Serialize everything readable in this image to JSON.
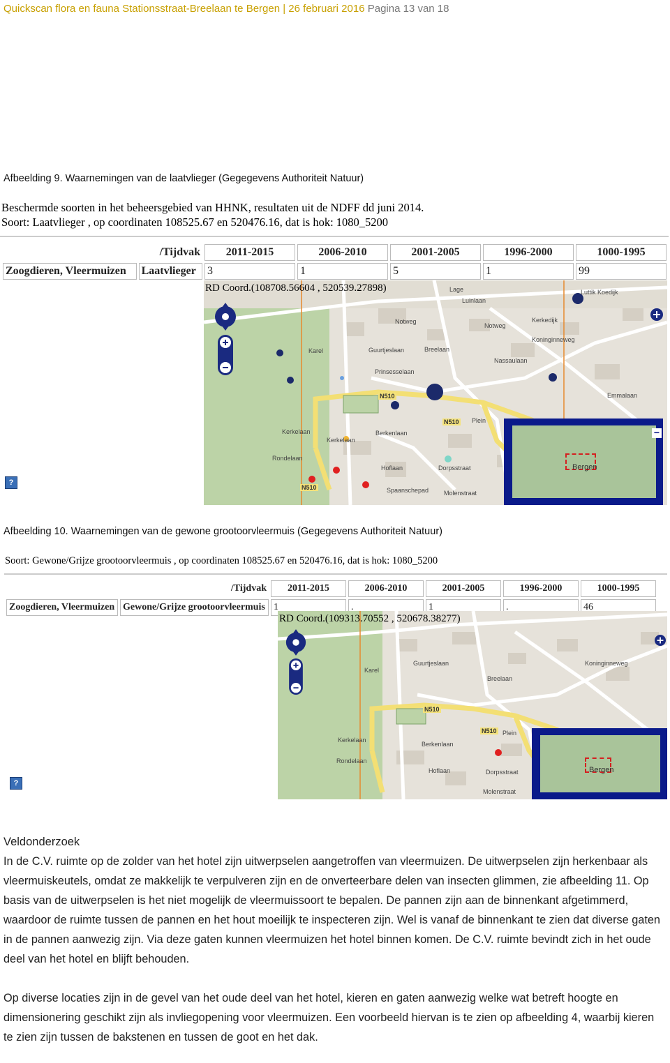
{
  "header": {
    "title": "Quickscan flora en fauna Stationsstraat-Breelaan te Bergen | 26 februari 2016",
    "page": "Pagina 13 van 18"
  },
  "figure9": {
    "caption": "Afbeelding 9. Waarnemingen van de laatvlieger (Gegegevens Authoriteit Natuur)",
    "line1": "Beschermde soorten in het beheersgebied van HHNK, resultaten uit de NDFF dd juni 2014.",
    "line2": "Soort: Laatvlieger , op coordinaten 108525.67 en 520476.16, dat is hok: 1080_5200",
    "table": {
      "headers": [
        "/Tijdvak",
        "2011-2015",
        "2006-2010",
        "2001-2005",
        "1996-2000",
        "1000-1995"
      ],
      "row": [
        "Zoogdieren, Vleermuizen",
        "Laatvlieger",
        "3",
        "1",
        "5",
        "1",
        "99"
      ]
    },
    "coord": "RD Coord.(108708.56604 , 520539.27898)",
    "map_labels": [
      "Luttik Koedijk",
      "Lage",
      "Luinlaan",
      "Notweg",
      "Notweg",
      "Kerkedijk",
      "Guurtjeslaan",
      "Prinsesselaan",
      "Breelaan",
      "Kerkelaan",
      "Kerkelaan",
      "Berkenlaan",
      "Hoflaan",
      "Dorpsstraat",
      "Molenstraat",
      "Spaanschepad",
      "Plein",
      "Emmalaan",
      "Koninginneweg",
      "Rondelaan",
      "Karel",
      "Nassaulaan"
    ],
    "road_labels": [
      "N510",
      "N510",
      "N510"
    ],
    "overview_label": "Bergen"
  },
  "figure10": {
    "caption": "Afbeelding 10. Waarnemingen van de gewone grootoorvleermuis (Gegegevens Authoriteit Natuur)",
    "line2": "Soort: Gewone/Grijze grootoorvleermuis , op coordinaten 108525.67 en 520476.16, dat is hok: 1080_5200",
    "table": {
      "headers": [
        "/Tijdvak",
        "2011-2015",
        "2006-2010",
        "2001-2005",
        "1996-2000",
        "1000-1995"
      ],
      "row": [
        "Zoogdieren, Vleermuizen",
        "Gewone/Grijze grootoorvleermuis",
        "1",
        ".",
        "1",
        ".",
        "46"
      ]
    },
    "coord": "RD Coord.(109313.70552 , 520678.38277)",
    "map_labels": [
      "Guurtjeslaan",
      "Breelaan",
      "Kerkelaan",
      "Berkenlaan",
      "Hoflaan",
      "Dorpsstraat",
      "Molenstraat",
      "Plein",
      "Koninginneweg",
      "Rondelaan",
      "Karel"
    ],
    "road_labels": [
      "N510",
      "N510"
    ],
    "overview_label": "Bergen"
  },
  "section": {
    "title": "Veldonderzoek",
    "paragraph1": "In de C.V. ruimte op de zolder van het hotel zijn uitwerpselen aangetroffen van vleermuizen. De uitwerpselen zijn herkenbaar als vleermuiskeutels, omdat ze makkelijk te verpulveren zijn en de onverteerbare delen van insecten glimmen, zie afbeelding 11. Op basis van de uitwerpselen is het niet mogelijk de vleermuissoort te bepalen. De pannen zijn aan de binnenkant afgetimmerd, waardoor de ruimte tussen de pannen en het hout moeilijk te inspecteren zijn. Wel is vanaf de binnenkant te zien dat diverse gaten in de pannen aanwezig zijn. Via deze gaten kunnen vleermuizen het hotel binnen komen. De C.V. ruimte bevindt zich in het oude deel van het hotel en blijft behouden.",
    "paragraph2": "Op diverse locaties zijn in de gevel van het oude deel van het hotel, kieren en gaten aanwezig welke wat betreft hoogte en dimensionering geschikt zijn als invliegopening voor vleermuizen. Een voorbeeld hiervan is te zien op afbeelding 4, waarbij kieren te zien zijn tussen de bakstenen en tussen de goot en het dak."
  },
  "icons": [
    "zoom-in-icon",
    "zoom-out-icon",
    "pan-arrows-icon",
    "help-icon",
    "minimize-icon",
    "observation-dot"
  ],
  "colors": {
    "header": "#c8a000",
    "map_panel": "#0a1a8a",
    "dot_navy": "#1c2a6a",
    "dot_red": "#e02020"
  }
}
